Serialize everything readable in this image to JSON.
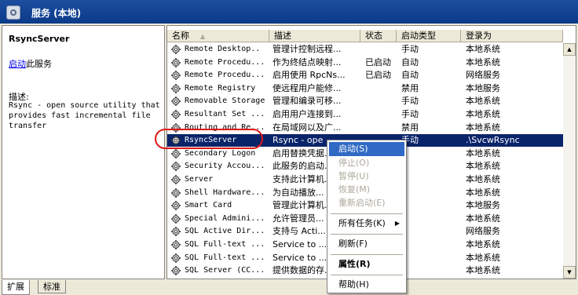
{
  "window": {
    "title": "服务 (本地)"
  },
  "left_pane": {
    "service_title": "RsyncServer",
    "action_link": "启动",
    "action_suffix": "此服务",
    "desc_label": "描述:",
    "description": "Rsync - open source utility that provides fast incremental file transfer"
  },
  "columns": [
    {
      "label": "名称"
    },
    {
      "label": "描述"
    },
    {
      "label": "状态"
    },
    {
      "label": "启动类型"
    },
    {
      "label": "登录为"
    }
  ],
  "rows": [
    {
      "name": "Remote Desktop..",
      "desc": "管理计控制远程...",
      "status": "",
      "start": "手动",
      "logon": "本地系统"
    },
    {
      "name": "Remote Procedu...",
      "desc": "作为终结点映射...",
      "status": "已启动",
      "start": "自动",
      "logon": "本地系统"
    },
    {
      "name": "Remote Procedu...",
      "desc": "启用使用 RpcNs...",
      "status": "已启动",
      "start": "自动",
      "logon": "网络服务"
    },
    {
      "name": "Remote Registry",
      "desc": "使远程用户能修...",
      "status": "",
      "start": "禁用",
      "logon": "本地服务"
    },
    {
      "name": "Removable Storage",
      "desc": "管理和编录可移...",
      "status": "",
      "start": "手动",
      "logon": "本地系统"
    },
    {
      "name": "Resultant Set ...",
      "desc": "启用用户连接到...",
      "status": "",
      "start": "手动",
      "logon": "本地系统"
    },
    {
      "name": "Routing and Re...",
      "desc": "在局域网以及广...",
      "status": "",
      "start": "禁用",
      "logon": "本地系统"
    },
    {
      "name": "RsyncServer",
      "desc": "Rsync - ope",
      "status": "",
      "start": "手动",
      "logon": ".\\SvcwRsync"
    },
    {
      "name": "Secondary Logon",
      "desc": "启用替换凭据...",
      "status": "",
      "start": "",
      "logon": "本地系统"
    },
    {
      "name": "Security Accou...",
      "desc": "此服务的启动...",
      "status": "",
      "start": "",
      "logon": "本地系统"
    },
    {
      "name": "Server",
      "desc": "支持此计算机...",
      "status": "",
      "start": "",
      "logon": "本地系统"
    },
    {
      "name": "Shell Hardware...",
      "desc": "为自动播放...",
      "status": "",
      "start": "",
      "logon": "本地系统"
    },
    {
      "name": "Smart Card",
      "desc": "管理此计算机...",
      "status": "",
      "start": "",
      "logon": "本地服务"
    },
    {
      "name": "Special Admini...",
      "desc": "允许管理员...",
      "status": "",
      "start": "",
      "logon": "本地系统"
    },
    {
      "name": "SQL Active Dir...",
      "desc": "支持与 Acti...",
      "status": "",
      "start": "",
      "logon": "网络服务"
    },
    {
      "name": "SQL Full-text ...",
      "desc": "Service to ...",
      "status": "",
      "start": "",
      "logon": "本地系统"
    },
    {
      "name": "SQL Full-text ...",
      "desc": "Service to ...",
      "status": "",
      "start": "",
      "logon": "本地系统"
    },
    {
      "name": "SQL Server (CC...",
      "desc": "提供数据的存...",
      "status": "",
      "start": "",
      "logon": "本地系统"
    }
  ],
  "context_menu": {
    "start": "启动(S)",
    "stop": "停止(O)",
    "pause": "暂停(U)",
    "resume": "恢复(M)",
    "restart": "重新启动(E)",
    "all_tasks": "所有任务(K)",
    "refresh": "刷新(F)",
    "properties": "属性(R)",
    "help": "帮助(H)"
  },
  "tabs": {
    "extended": "扩展",
    "standard": "标准"
  },
  "colors": {
    "title_bar": "#0b3a8a",
    "selection": "#0a246a",
    "menu_highlight": "#316ac5",
    "circle": "#e01818"
  }
}
